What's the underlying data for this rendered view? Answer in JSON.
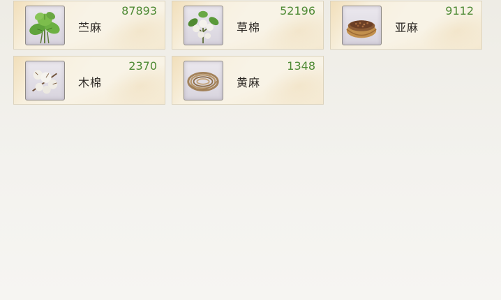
{
  "inventory": {
    "items": [
      {
        "name": "苎麻",
        "count": "87893",
        "icon": "ramie-plant-icon"
      },
      {
        "name": "草棉",
        "count": "52196",
        "icon": "cotton-plant-icon"
      },
      {
        "name": "亚麻",
        "count": "9112",
        "icon": "flax-seed-bowl-icon"
      },
      {
        "name": "木棉",
        "count": "2370",
        "icon": "kapok-boll-icon"
      },
      {
        "name": "黄麻",
        "count": "1348",
        "icon": "jute-fiber-icon"
      }
    ]
  },
  "colors": {
    "count_text": "#4e8a34",
    "name_text": "#2a2622",
    "card_bg": "#f8f3e6",
    "card_border": "#dcd3bd"
  }
}
